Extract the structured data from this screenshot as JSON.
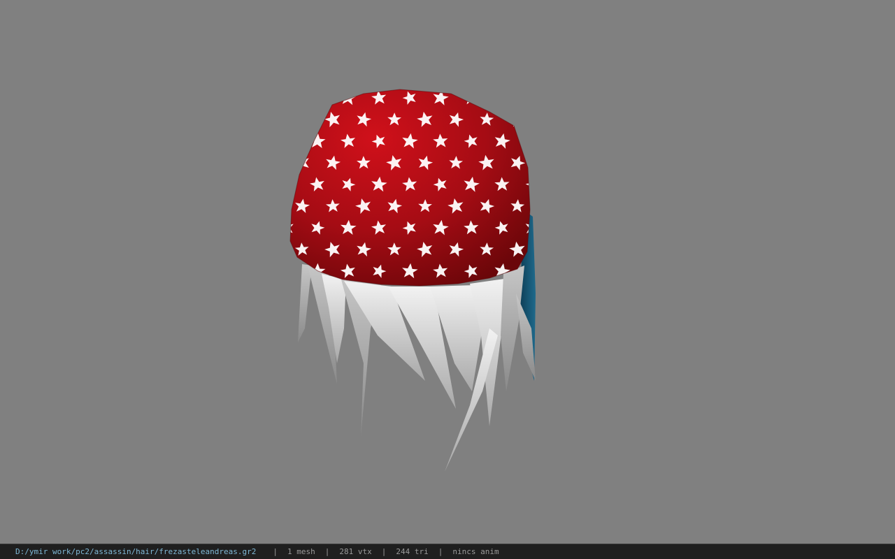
{
  "viewer": {
    "background_color": "#808080",
    "model": {
      "cap_color": "#b01018",
      "star_color": "#ffffff",
      "hair_color": "#e2e2e2",
      "back_color": "#1a5a7a"
    }
  },
  "status_bar": {
    "file_path": "D:/ymir work/pc2/assassin/hair/frezasteleandreas.gr2",
    "separator": "|",
    "mesh_count": "1 mesh",
    "vertex_count": "281 vtx",
    "triangle_count": "244 tri",
    "anim_status": "nincs anim"
  }
}
